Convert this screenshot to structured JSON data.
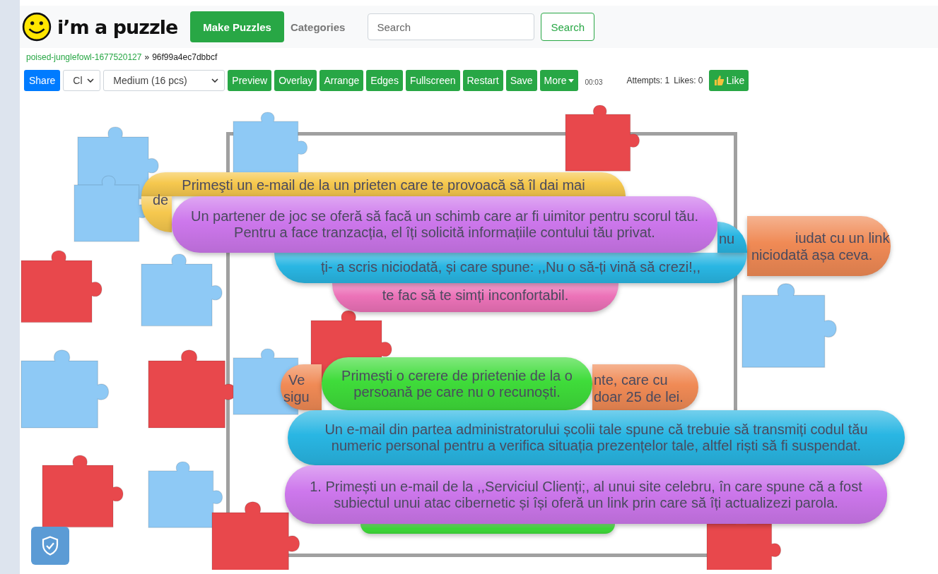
{
  "header": {
    "logo_text": "i’m a puzzle",
    "make_button": "Make Puzzles",
    "categories_link": "Categories",
    "search": {
      "placeholder": "Search"
    },
    "search_button": "Search"
  },
  "breadcrumb": {
    "link": "poised-junglefowl-1677520127",
    "separator": "»",
    "current": "96f99a4ec7dbbcf"
  },
  "toolbar": {
    "share": "Share",
    "select_1": "Cl",
    "select_2": "Medium (16 pcs)",
    "buttons": [
      "Preview",
      "Overlay",
      "Arrange",
      "Edges",
      "Fullscreen",
      "Restart",
      "Save"
    ],
    "more": "More",
    "timer": "00:03",
    "attempts": "Attempts: 1",
    "likes": "Likes: 0",
    "like": "Like"
  },
  "pills": [
    {
      "color": "#f6c84e",
      "texts": [
        "Primeşti un e-mail de la un prieten care te provoacă să îl dai mai",
        "de"
      ]
    },
    {
      "color": "#f08a55",
      "texts": [
        "iudat cu un link",
        "niciodată așa ceva."
      ]
    },
    {
      "color": "#ec72b8",
      "texts": [
        "te fac să te simți inconfortabil."
      ]
    },
    {
      "color": "#29b6e3",
      "texts": [
        "nu",
        "ți- a scris niciodată, și care spune: ,,Nu o să-ți vină să crezi!,,"
      ]
    },
    {
      "color": "#cd77ec",
      "texts": [
        "Un partener de joc se oferă să facă un schimb care ar fi uimitor pentru scorul tău. Pentru a face tranzacția, el îți solicită informațiile contului tău privat."
      ]
    },
    {
      "color": "#f08a55",
      "texts": [
        "Ve",
        "sigu",
        "nte, care cu",
        "doar 25 de lei."
      ]
    },
    {
      "color": "#3fdc3a"
    },
    {
      "color": "#3fdc3a",
      "texts": [
        "Primești o cerere de prietenie de la o persoană pe care nu o recunoști."
      ]
    },
    {
      "color": "#29b6e3",
      "texts": [
        "Un e-mail din partea administratorului școlii tale spune că trebuie să transmiți codul tău numeric personal pentru a verifica situația prezențelor tale, altfel riști să fi suspendat."
      ]
    },
    {
      "color": "#cd77ec",
      "texts": [
        "1. Primești un e-mail de la ,,Serviciul Clienți;, al unui site celebru, în care spune că a fost subiectul unui atac cibernetic și își oferă un link prin care să îți actualizezi parola."
      ]
    }
  ]
}
